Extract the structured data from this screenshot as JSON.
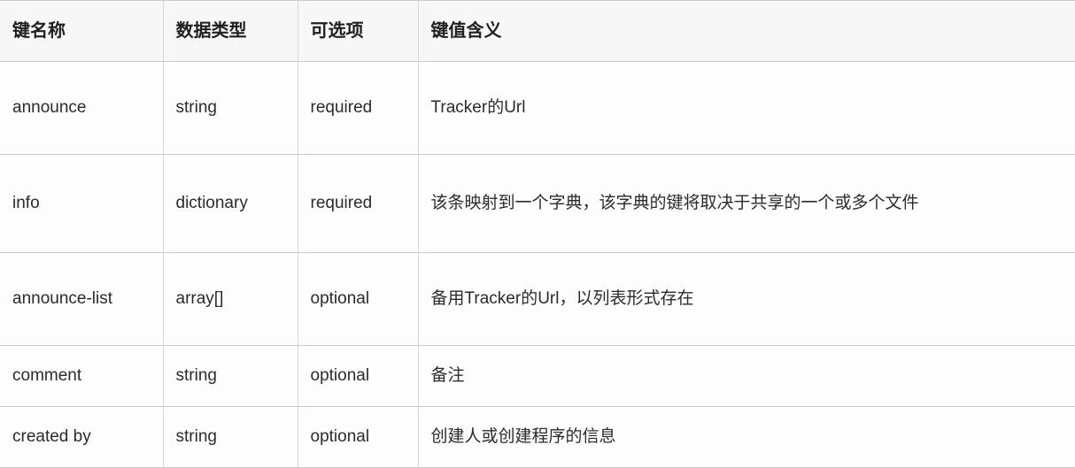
{
  "table": {
    "columns": [
      {
        "id": "key",
        "label": "键名称"
      },
      {
        "id": "type",
        "label": "数据类型"
      },
      {
        "id": "opt",
        "label": "可选项"
      },
      {
        "id": "desc",
        "label": "键值含义"
      }
    ],
    "rows": [
      {
        "key": "announce",
        "type": "string",
        "opt": "required",
        "desc": "Tracker的Url"
      },
      {
        "key": "info",
        "type": "dictionary",
        "opt": "required",
        "desc": "该条映射到一个字典，该字典的键将取决于共享的一个或多个文件"
      },
      {
        "key": "announce-list",
        "type": "array[]",
        "opt": "optional",
        "desc": "备用Tracker的Url，以列表形式存在"
      },
      {
        "key": "comment",
        "type": "string",
        "opt": "optional",
        "desc": "备注"
      },
      {
        "key": "created by",
        "type": "string",
        "opt": "optional",
        "desc": "创建人或创建程序的信息"
      }
    ]
  },
  "colors": {
    "header_background": "#f7f7f7",
    "cell_background": "#fdfdfd",
    "border": "#c9c9c9",
    "text": "#2b2b2b"
  }
}
